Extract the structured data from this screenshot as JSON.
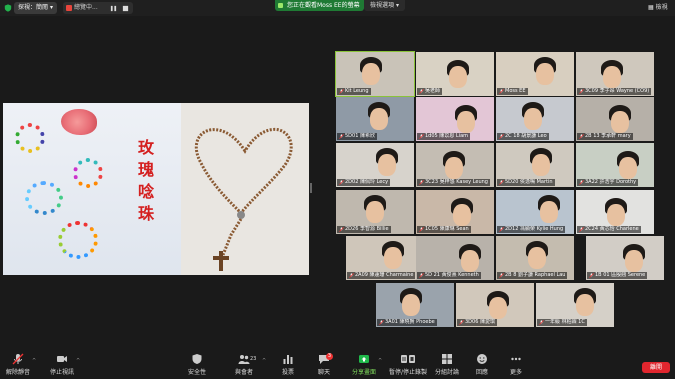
{
  "topbar": {
    "view_label": "探視：簡閱",
    "share_label": "總覽中...",
    "banner": "您正在觀看Moss EE的螢幕",
    "view_options": "檢視選項",
    "gallery_label": "檢視"
  },
  "shared": {
    "title": "玫瑰唸珠",
    "colors": {
      "accent_red": "#d42020"
    }
  },
  "participants": [
    {
      "name": "Kit Leung"
    },
    {
      "name": "吳老師"
    },
    {
      "name": "Moss EE"
    },
    {
      "name": "3C09 李子昂 Wayne (CO9)"
    },
    {
      "name": "5D01 陳希欣"
    },
    {
      "name": "1d05 陳苡恩 Liam"
    },
    {
      "name": "2C 18 胡景謙 Leo"
    },
    {
      "name": "2B 13 李承軒 mary"
    },
    {
      "name": "2D02 陳佩玲 Lecy"
    },
    {
      "name": "3C23 吳梓悠 Kasey Leung"
    },
    {
      "name": "5D20 侯逸鳴 Martin"
    },
    {
      "name": "3A22 許浩宇 Dorothy"
    },
    {
      "name": "2D26 李智源 Billie"
    },
    {
      "name": "1C05 陳康琳 Sean"
    },
    {
      "name": "2D12 馮顯榮 Kylie Hung"
    },
    {
      "name": "2C24 黃芯怡 Charlene"
    },
    {
      "name": "2A09 陳蓮珊 Charmaine"
    },
    {
      "name": "5D 21 黃俊熹 Kenneth"
    },
    {
      "name": "2B 8 劉子謙 Raphael Lau"
    },
    {
      "name": "1B 01 區殷翹 Serene"
    },
    {
      "name": "3A01 陳曉賢 Phoebe"
    },
    {
      "name": "3D06 陳愛琪"
    },
    {
      "name": "一年級 林柏霖 1C"
    }
  ],
  "toolbar": {
    "mute": "解除靜音",
    "video": "停止視訊",
    "security": "安全性",
    "participants": "與會者",
    "participants_count": "23",
    "polls": "投票",
    "chat": "聊天",
    "chat_badge": "3",
    "share": "分享畫面",
    "record": "暫停/停止錄製",
    "breakout": "分組討論",
    "reactions": "回應",
    "more": "更多",
    "leave": "離開"
  }
}
